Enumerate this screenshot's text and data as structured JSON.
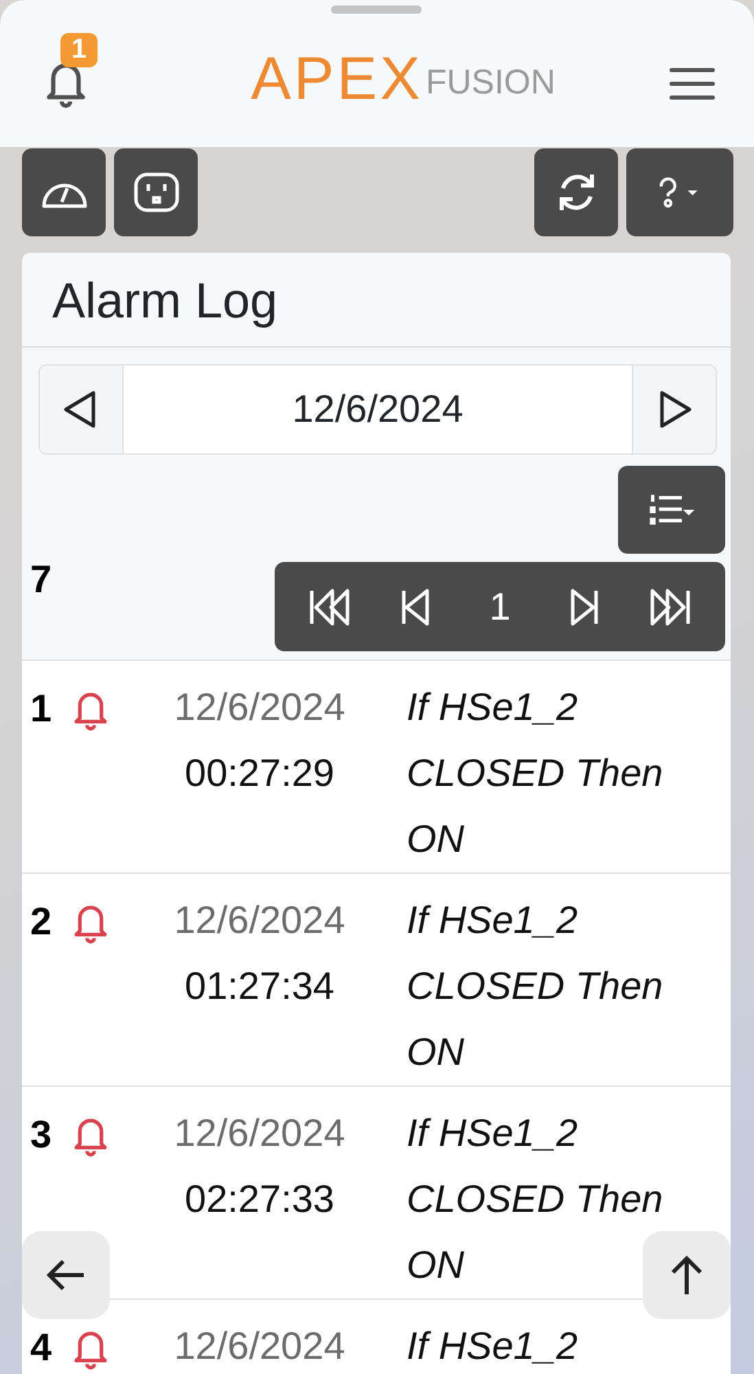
{
  "header": {
    "notification_count": "1",
    "logo": {
      "brand": "APEX",
      "sub": "FUSION"
    }
  },
  "card": {
    "title": "Alarm Log",
    "date": "12/6/2024",
    "total": "7",
    "page": "1"
  },
  "rows": [
    {
      "number": "1",
      "date": "12/6/2024",
      "time": "00:27:29",
      "message": "If HSe1_2 CLOSED Then ON"
    },
    {
      "number": "2",
      "date": "12/6/2024",
      "time": "01:27:34",
      "message": "If HSe1_2 CLOSED Then ON"
    },
    {
      "number": "3",
      "date": "12/6/2024",
      "time": "02:27:33",
      "message": "If HSe1_2 CLOSED Then ON"
    },
    {
      "number": "4",
      "date": "12/6/2024",
      "message": "If HSe1_2"
    }
  ]
}
